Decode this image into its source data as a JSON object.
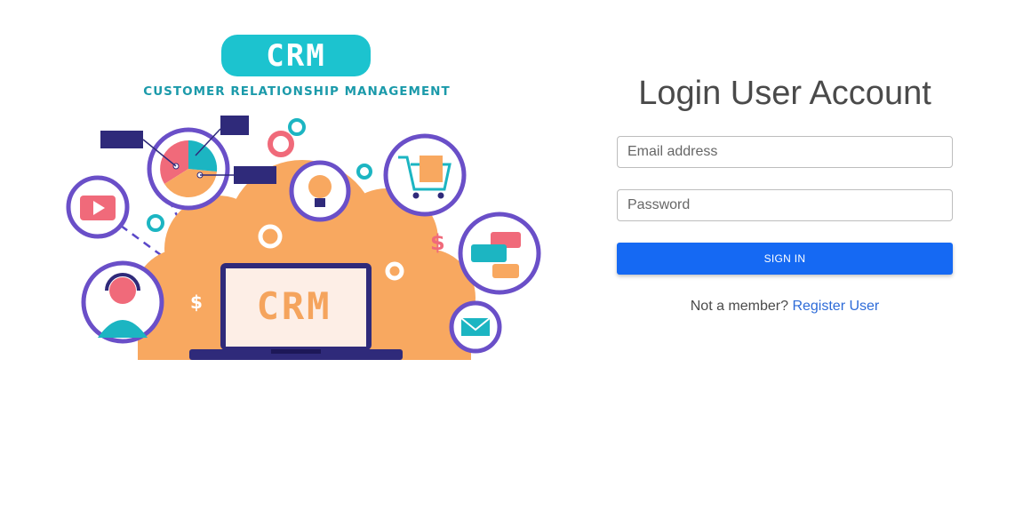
{
  "illustration": {
    "badge": "CRM",
    "subtitle": "CUSTOMER RELATIONSHIP MANAGEMENT",
    "laptop_text": "CRM"
  },
  "login": {
    "title": "Login User Account",
    "email_placeholder": "Email address",
    "password_placeholder": "Password",
    "sign_in_label": "SIGN IN",
    "not_member_text": "Not a member?",
    "register_link": "Register User"
  },
  "colors": {
    "accent": "#1569f3",
    "link": "#2d6bd8",
    "badge": "#1cc3cf",
    "cloud": "#f8a860",
    "ring": "#6a4fc8"
  }
}
